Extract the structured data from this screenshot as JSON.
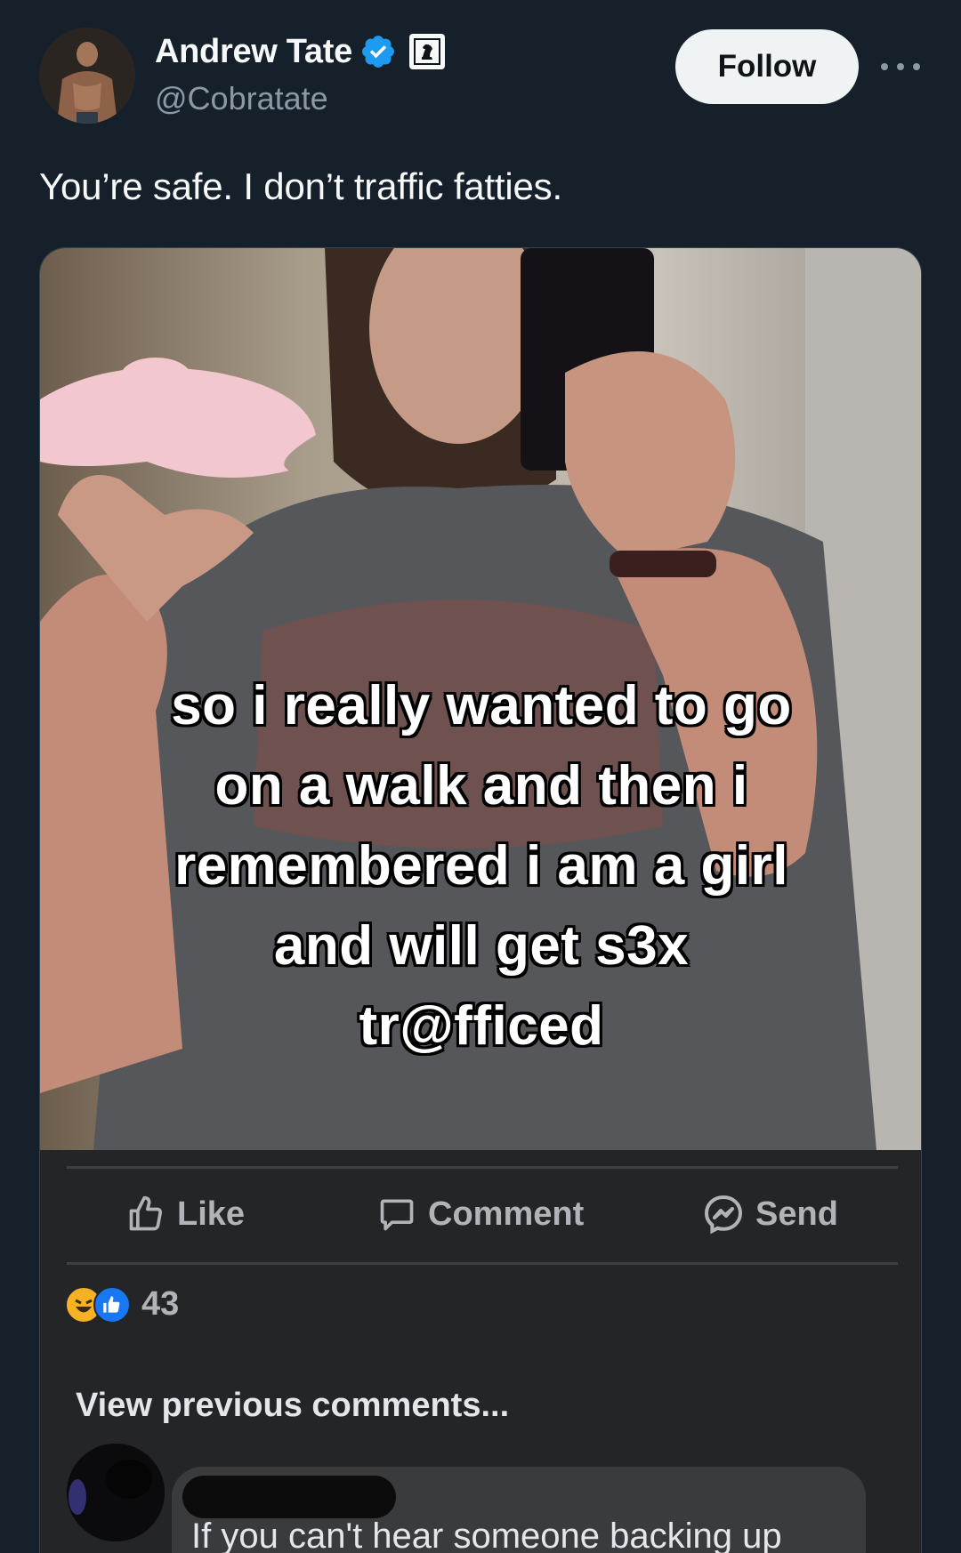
{
  "author": {
    "name": "Andrew Tate",
    "handle": "@Cobratate",
    "verified_icon": "verified-badge-icon",
    "affiliate_icon": "chess-knight-icon"
  },
  "follow_label": "Follow",
  "more_icon": "more-horizontal-icon",
  "tweet_text": "You’re safe. I don’t traffic fatties.",
  "media": {
    "caption_lines": [
      "so i really wanted to go",
      "on a walk and then i",
      "remembered i am a girl",
      "and will get s3x",
      "tr@fficed"
    ],
    "facebook_actions": {
      "like": "Like",
      "comment": "Comment",
      "send": "Send"
    },
    "reaction_count": "43",
    "view_previous": "View previous comments...",
    "comment_text": "If you can't hear someone backing up"
  },
  "colors": {
    "background": "#15202b",
    "verified": "#1d9bf0",
    "follow_bg": "#eff3f4",
    "fb_bg": "#242526"
  }
}
